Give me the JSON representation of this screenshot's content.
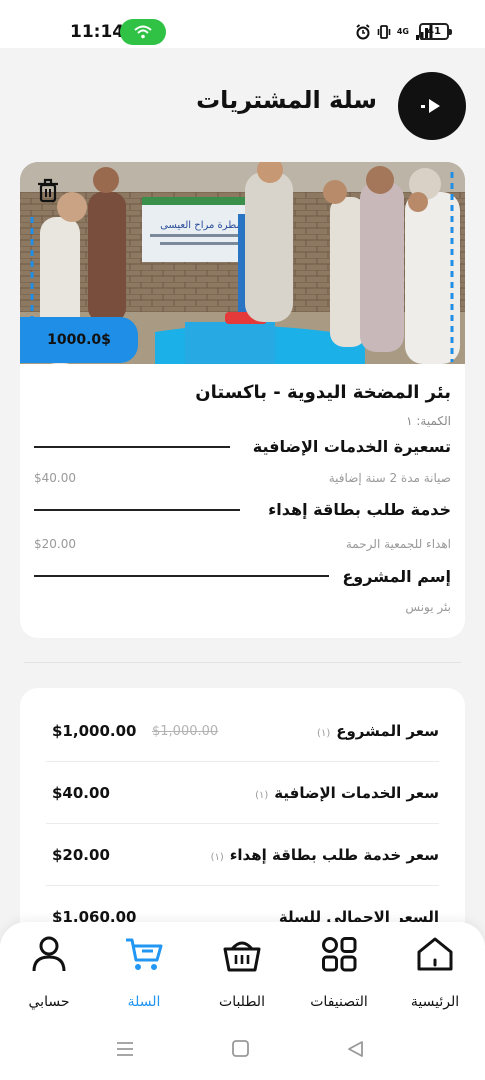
{
  "status_bar": {
    "time": "11:14",
    "network": "4G",
    "battery": "41"
  },
  "header": {
    "title": "سلة المشتريات"
  },
  "product": {
    "photo_banner_text": "مطرة مراح العيسى",
    "price_badge": "1000.0$",
    "title": "بئر المضخة اليدوية - باكستان",
    "quantity_label": "الكمية: ١",
    "extra_services": {
      "heading": "تسعيرة الخدمات الإضافية",
      "item_name": "صيانة مدة 2 سنة إضافية",
      "item_price": "$40.00"
    },
    "gift_card": {
      "heading": "خدمة طلب بطاقة إهداء",
      "item_name": "اهداء للجمعية الرحمة",
      "item_price": "$20.00"
    },
    "project_name": {
      "heading": "إسم المشروع",
      "value": "بئر يونس"
    }
  },
  "summary": {
    "rows": [
      {
        "label": "سعر المشروع",
        "count": "(١)",
        "value": "$1,000.00",
        "old_value": "$1,000.00"
      },
      {
        "label": "سعر الخدمات الإضافية",
        "count": "(١)",
        "value": "$40.00"
      },
      {
        "label": "سعر خدمة طلب بطاقة إهداء",
        "count": "(١)",
        "value": "$20.00"
      },
      {
        "label": "السعر الاجمالي للسلة",
        "value": "$1,060.00"
      }
    ]
  },
  "bottom_nav": {
    "items": [
      {
        "label": "الرئيسية",
        "icon": "home-icon"
      },
      {
        "label": "التصنيفات",
        "icon": "categories-icon"
      },
      {
        "label": "الطلبات",
        "icon": "basket-icon"
      },
      {
        "label": "السلة",
        "icon": "cart-icon",
        "active": true
      },
      {
        "label": "حسابي",
        "icon": "user-icon"
      }
    ]
  },
  "colors": {
    "accent": "#1f8ee6",
    "active_nav": "#2196f3",
    "status_pill": "#2fc244"
  }
}
